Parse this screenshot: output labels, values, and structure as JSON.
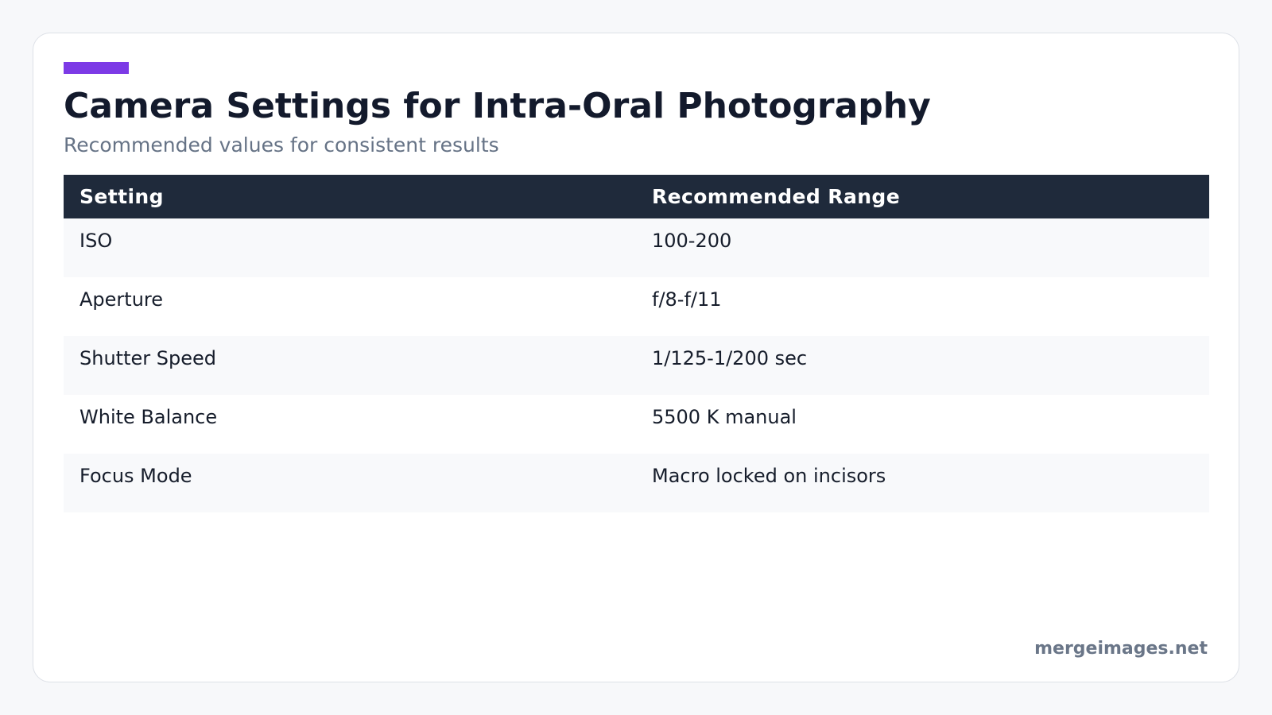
{
  "header": {
    "title": "Camera Settings for Intra-Oral Photography",
    "subtitle": "Recommended values for consistent results",
    "accent_color": "#7c3ae6"
  },
  "table": {
    "columns": [
      "Setting",
      "Recommended Range"
    ],
    "rows": [
      [
        "ISO",
        "100-200"
      ],
      [
        "Aperture",
        "f/8-f/11"
      ],
      [
        "Shutter Speed",
        "1/125-1/200 sec"
      ],
      [
        "White Balance",
        "5500 K manual"
      ],
      [
        "Focus Mode",
        "Macro locked on incisors"
      ]
    ],
    "header_color": "#1f2a3b"
  },
  "footer": {
    "watermark": "mergeimages.net"
  }
}
